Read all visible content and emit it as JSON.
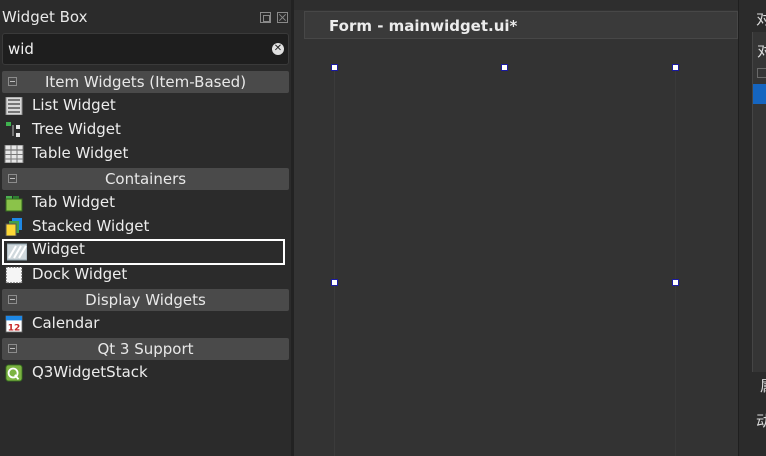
{
  "widget_box": {
    "title": "Widget Box",
    "search": {
      "value": "wid",
      "placeholder": ""
    },
    "categories": [
      {
        "label": "Item Widgets (Item-Based)",
        "items": [
          {
            "label": "List Widget",
            "icon": "list-widget-icon"
          },
          {
            "label": "Tree Widget",
            "icon": "tree-widget-icon"
          },
          {
            "label": "Table Widget",
            "icon": "table-widget-icon"
          }
        ]
      },
      {
        "label": "Containers",
        "items": [
          {
            "label": "Tab Widget",
            "icon": "tab-widget-icon"
          },
          {
            "label": "Stacked Widget",
            "icon": "stacked-widget-icon"
          },
          {
            "label": "Widget",
            "icon": "widget-icon",
            "selected": true
          },
          {
            "label": "Dock Widget",
            "icon": "dock-widget-icon"
          }
        ]
      },
      {
        "label": "Display Widgets",
        "items": [
          {
            "label": "Calendar",
            "icon": "calendar-icon"
          }
        ]
      },
      {
        "label": "Qt 3 Support",
        "items": [
          {
            "label": "Q3WidgetStack",
            "icon": "q3-widget-stack-icon"
          }
        ]
      }
    ]
  },
  "form": {
    "title": "Form - mainwidget.ui*"
  },
  "right_panel": {
    "chars": [
      "对",
      "对",
      "属",
      "动"
    ]
  },
  "colors": {
    "selection_blue": "#1565c0",
    "handle_border": "#1a1aa0",
    "background": "#2b2b2b"
  }
}
